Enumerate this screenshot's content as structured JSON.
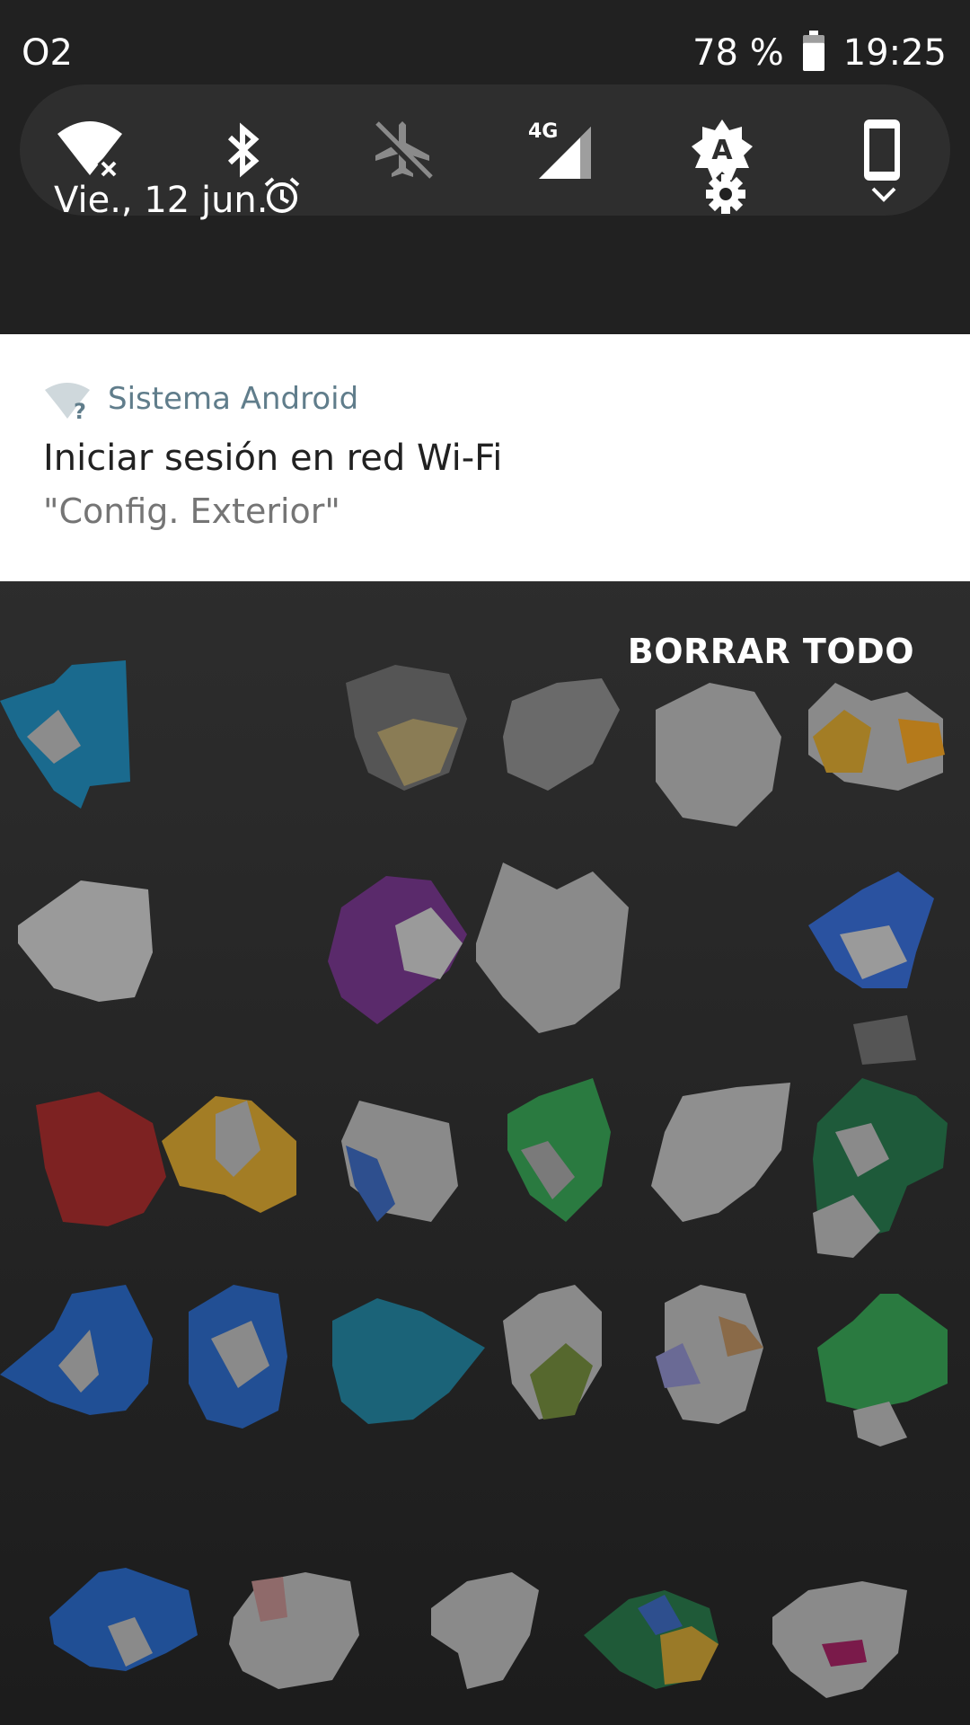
{
  "status_bar": {
    "carrier": "O2",
    "battery_percent": "78 %",
    "battery_level": 0.78,
    "time": "19:25",
    "icons": [
      "battery-icon"
    ]
  },
  "quick_settings": {
    "tiles": [
      {
        "icon": "wifi-off-icon",
        "active": true
      },
      {
        "icon": "bluetooth-icon",
        "active": true
      },
      {
        "icon": "airplane-mode-icon",
        "active": false
      },
      {
        "icon": "mobile-data-4g-icon",
        "active": true
      },
      {
        "icon": "auto-brightness-icon",
        "active": true
      },
      {
        "icon": "auto-rotate-icon",
        "active": true
      }
    ],
    "date": "Vie., 12 jun.",
    "footer_icons": [
      "alarm-icon",
      "settings-icon",
      "chevron-down-icon"
    ]
  },
  "notification": {
    "app_name": "Sistema Android",
    "app_icon": "wifi-question-icon",
    "title": "Iniciar sesión en red Wi-Fi",
    "text": "\"Config. Exterior\""
  },
  "clear_all_label": "BORRAR TODO",
  "colors": {
    "panel_bg": "#212121",
    "tiles_bg": "#2e2e2e",
    "notification_bg": "#ffffff",
    "app_name": "#607d8b",
    "title": "#212121",
    "subtitle": "#757575",
    "inactive_icon": "#8a8a8a"
  }
}
